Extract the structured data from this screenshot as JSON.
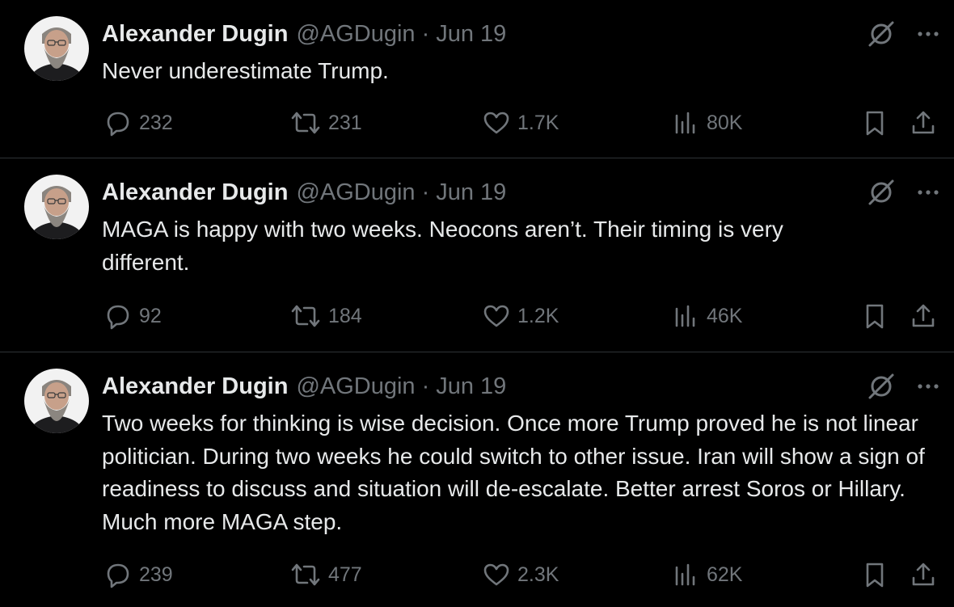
{
  "tweets": [
    {
      "author": "Alexander Dugin",
      "handle": "@AGDugin",
      "separator": "·",
      "date": "Jun 19",
      "text": "Never underestimate Trump.",
      "replies": "232",
      "retweets": "231",
      "likes": "1.7K",
      "views": "80K"
    },
    {
      "author": "Alexander Dugin",
      "handle": "@AGDugin",
      "separator": "·",
      "date": "Jun 19",
      "text": "MAGA is happy with two weeks. Neocons aren’t. Their timing is very different.",
      "replies": "92",
      "retweets": "184",
      "likes": "1.2K",
      "views": "46K"
    },
    {
      "author": "Alexander Dugin",
      "handle": "@AGDugin",
      "separator": "·",
      "date": "Jun 19",
      "text": "Two weeks for thinking is wise decision. Once more Trump proved he is not linear politician. During two weeks he could switch to other issue. Iran will show a sign of readiness to discuss and situation will de-escalate. Better arrest Soros or Hillary. Much more MAGA step.",
      "replies": "239",
      "retweets": "477",
      "likes": "2.3K",
      "views": "62K"
    }
  ],
  "icons": {
    "reply": "reply-icon",
    "retweet": "retweet-icon",
    "like": "heart-icon",
    "views": "views-icon",
    "bookmark": "bookmark-icon",
    "share": "share-icon",
    "grok": "grok-icon",
    "more": "more-icon"
  },
  "colors": {
    "background": "#000000",
    "text": "#e7e9ea",
    "secondary": "#71767b",
    "divider": "#2f3336"
  }
}
